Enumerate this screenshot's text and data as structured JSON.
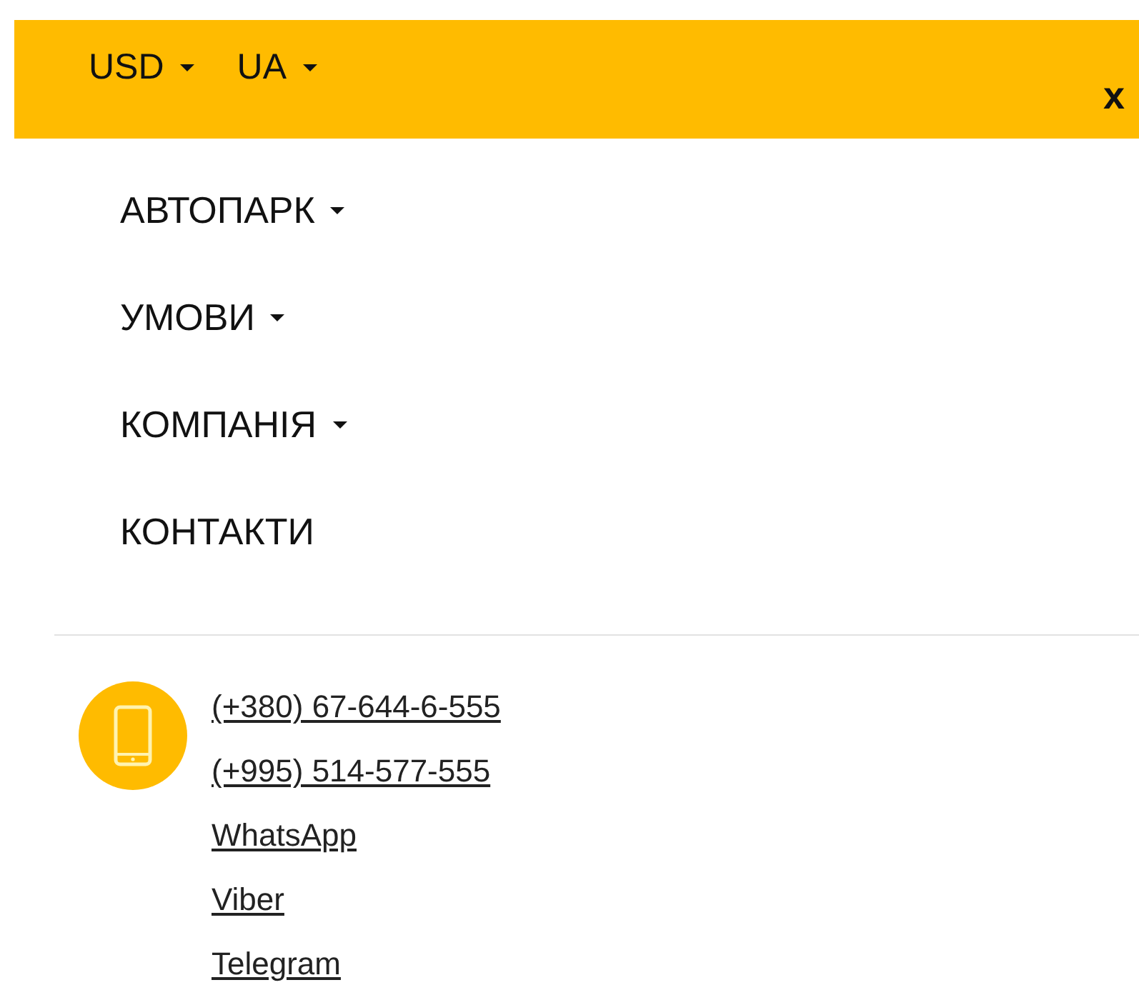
{
  "top_bar": {
    "selectors": [
      {
        "label": "USD",
        "dropdown": true
      },
      {
        "label": "UA",
        "dropdown": true
      }
    ],
    "close": "x"
  },
  "menu": [
    {
      "label": "АВТОПАРК",
      "dropdown": true
    },
    {
      "label": "УМОВИ",
      "dropdown": true
    },
    {
      "label": "КОМПАНІЯ",
      "dropdown": true
    },
    {
      "label": "КОНТАКТИ",
      "dropdown": false
    }
  ],
  "contacts": [
    "(+380) 67-644-6-555",
    "(+995) 514-577-555",
    "WhatsApp",
    "Viber",
    "Telegram"
  ]
}
